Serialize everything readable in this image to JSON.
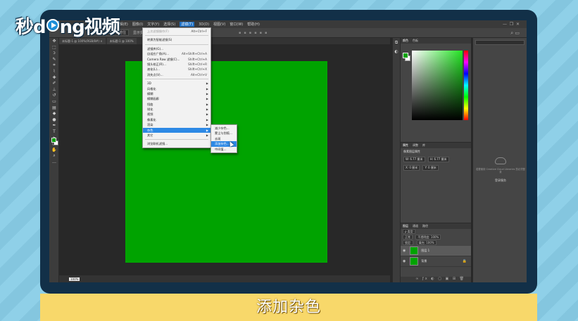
{
  "watermark": {
    "prefix": "秒d",
    "suffix": "ng视频"
  },
  "menubar": {
    "items": [
      "文件(F)",
      "编辑(E)",
      "图像(I)",
      "文字(Y)",
      "选择(S)",
      "滤镜(T)",
      "3D(D)",
      "视图(V)",
      "窗口(W)",
      "帮助(H)"
    ],
    "active_index": 5
  },
  "options_bar": {
    "label": "选择并遮住",
    "mode": "显示变换控件"
  },
  "document_tab": {
    "title": "未标题-1 @ 100%(RGB/8#) ×",
    "second": "未标题-1 @ 100%"
  },
  "filter_menu": {
    "items": [
      {
        "label": "上次滤镜操作(F)",
        "shortcut": "Alt+Ctrl+F",
        "disabled": true
      },
      {
        "sep": true
      },
      {
        "label": "转换为智能滤镜(S)"
      },
      {
        "sep": true
      },
      {
        "label": "滤镜库(G)..."
      },
      {
        "label": "自适应广角(A)...",
        "shortcut": "Alt+Shift+Ctrl+A"
      },
      {
        "label": "Camera Raw 滤镜(C)...",
        "shortcut": "Shift+Ctrl+A"
      },
      {
        "label": "镜头校正(R)...",
        "shortcut": "Shift+Ctrl+R"
      },
      {
        "label": "液化(L)...",
        "shortcut": "Shift+Ctrl+X"
      },
      {
        "label": "消失点(V)...",
        "shortcut": "Alt+Ctrl+V"
      },
      {
        "sep": true
      },
      {
        "label": "3D",
        "submenu": true
      },
      {
        "label": "风格化",
        "submenu": true
      },
      {
        "label": "模糊",
        "submenu": true
      },
      {
        "label": "模糊画廊",
        "submenu": true
      },
      {
        "label": "扭曲",
        "submenu": true
      },
      {
        "label": "锐化",
        "submenu": true
      },
      {
        "label": "视频",
        "submenu": true
      },
      {
        "label": "像素化",
        "submenu": true
      },
      {
        "label": "渲染",
        "submenu": true
      },
      {
        "label": "杂色",
        "submenu": true,
        "highlighted": true
      },
      {
        "label": "其它",
        "submenu": true
      },
      {
        "sep": true
      },
      {
        "label": "浏览联机滤镜..."
      }
    ]
  },
  "noise_submenu": {
    "items": [
      {
        "label": "减少杂色..."
      },
      {
        "label": "蒙尘与划痕..."
      },
      {
        "label": "去斑"
      },
      {
        "label": "添加杂色...",
        "highlighted": true
      },
      {
        "label": "中间值..."
      }
    ]
  },
  "colors": {
    "canvas": "#00a300",
    "foreground": "#00a300",
    "background": "#ffffff",
    "accent": "#2d89e5"
  },
  "color_panel": {
    "tabs": [
      "颜色",
      "色板"
    ]
  },
  "properties_panel": {
    "tabs": [
      "属性",
      "调整",
      "库"
    ],
    "heading": "像素图层属性",
    "w": "W: 6.77 厘米",
    "h": "H: 6.77 厘米",
    "x": "X: 0 厘米",
    "y": "Y: 0 厘米"
  },
  "layers_panel": {
    "tabs": [
      "图层",
      "通道",
      "路径"
    ],
    "kind": "ρ 类型",
    "blend": "正常",
    "opacity": "不透明度: 100%",
    "lock": "锁定:",
    "fill": "填充: 100%",
    "layers": [
      {
        "name": "图层 1",
        "selected": true
      },
      {
        "name": "背景",
        "selected": false,
        "locked": true
      }
    ]
  },
  "libraries_panel": {
    "message": "若要使用 Creative Cloud Libraries 您必须登录",
    "link": "登录服务"
  },
  "status": {
    "zoom": "100%"
  },
  "caption": "添加杂色"
}
